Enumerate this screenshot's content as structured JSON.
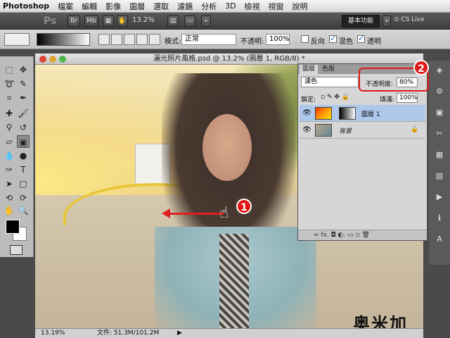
{
  "menubar": {
    "app_name": "Photoshop",
    "items": [
      "檔案",
      "編輯",
      "影像",
      "圖層",
      "選取",
      "濾鏡",
      "分析",
      "3D",
      "檢視",
      "視窗",
      "說明"
    ]
  },
  "appbar": {
    "logo": "Ps",
    "br": "Br",
    "mb": "Mb",
    "zoom": "13.2%",
    "more": "»",
    "workspace": "基本功能",
    "cs_live": "CS Live"
  },
  "options": {
    "mode_label": "模式:",
    "mode_value": "正常",
    "opacity_label": "不透明:",
    "opacity_value": "100%",
    "reverse_label": "反向",
    "dither_label": "混色",
    "transparency_label": "透明"
  },
  "document": {
    "title": "灑光照片風格.psd @ 13.2% (圖層 1, RGB/8) *",
    "zoom": "13.19%",
    "file_info": "文件: 51.3M/101.2M",
    "badge1": "1",
    "badge2": "2",
    "watermark": "奥米加"
  },
  "layers": {
    "tab_layers": "圖層",
    "tab_channels": "色版",
    "blend_mode": "濾色",
    "opacity_label": "不透明度:",
    "opacity_value": "80%",
    "lock_label": "鎖定:",
    "fill_label": "填滿:",
    "fill_value": "100%",
    "items": [
      {
        "name": "圖層 1"
      },
      {
        "name": "背景"
      }
    ],
    "bottom_icons": "∞  fx.  ◘  ◐.  ▭  ▫  🗑"
  },
  "colors": {
    "accent": "#e01818",
    "selected_layer": "#adc8ea"
  }
}
